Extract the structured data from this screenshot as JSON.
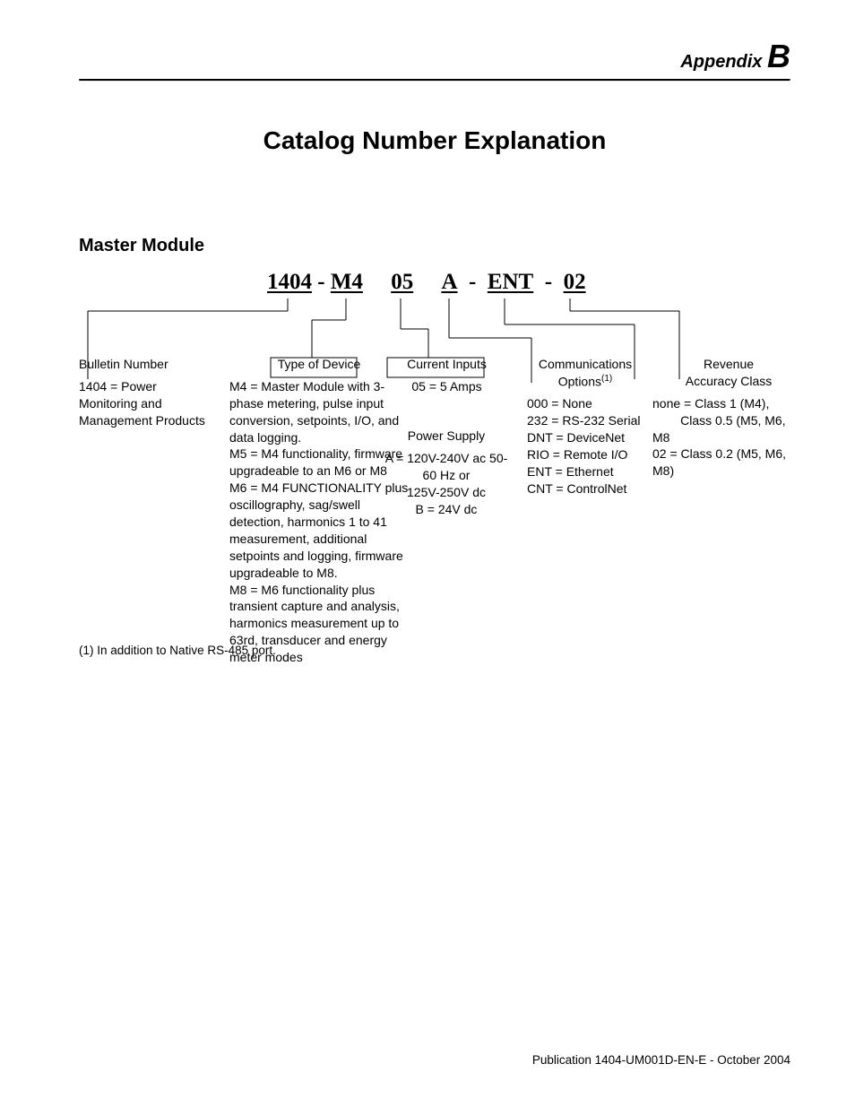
{
  "appendix_label": "Appendix",
  "appendix_letter": "B",
  "page_title": "Catalog Number Explanation",
  "section_title": "Master Module",
  "catalog": {
    "p1": "1404",
    "sep1": " - ",
    "p2": "M4",
    "gap1": "     ",
    "p3": "05",
    "gap2": "     ",
    "p4": "A",
    "sep3": "  -  ",
    "p5": "ENT",
    "sep4": "  -  ",
    "p6": "02"
  },
  "col1": {
    "head": "Bulletin Number",
    "body": "1404 = Power Monitoring and Management Products"
  },
  "col2": {
    "head": "Type of Device",
    "body": "M4 = Master Module with 3-phase metering, pulse input conversion, setpoints, I/O, and data logging.\nM5 = M4 functionality, firmware upgradeable to an M6 or M8\nM6 = M4 FUNCTIONALITY plus oscillography, sag/swell detection, harmonics 1 to 41 measurement, additional setpoints and logging, firmware upgradeable to M8.\nM8 = M6 functionality plus transient capture and analysis, harmonics measurement up to 63rd, transducer and energy meter modes"
  },
  "col3": {
    "head": "Current Inputs",
    "body": "05 = 5 Amps"
  },
  "col4": {
    "head": "Power Supply",
    "body": "A = 120V-240V ac 50-60 Hz or\n125V-250V dc\nB = 24V dc"
  },
  "col5": {
    "head_pre": "Communications Options",
    "head_sup": "(1)",
    "body": "000 = None\n232 = RS-232 Serial\nDNT = DeviceNet\nRIO = Remote I/O\nENT = Ethernet\nCNT = ControlNet"
  },
  "col6": {
    "head": "Revenue\nAccuracy Class",
    "body": "none = Class 1 (M4),\n        Class 0.5 (M5, M6, M8\n02 = Class 0.2 (M5, M6, M8)"
  },
  "footnote": "(1) In addition to Native RS-485 port.",
  "publication": "Publication 1404-UM001D-EN-E - October 2004"
}
